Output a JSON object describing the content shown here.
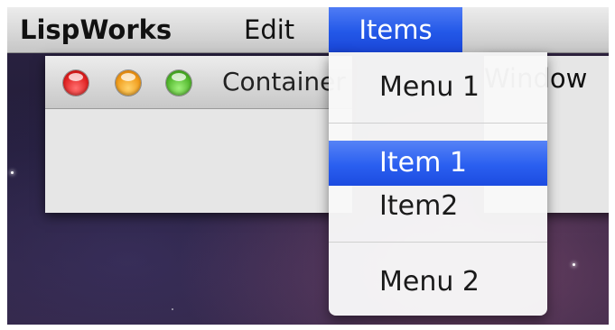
{
  "menubar": {
    "app_name": "LispWorks",
    "menus": [
      {
        "label": "Edit"
      },
      {
        "label": "Items",
        "active": true
      },
      {
        "label": "Window"
      }
    ],
    "highlight_color": "#2358e8"
  },
  "window": {
    "title": "Container",
    "buttons": [
      "close",
      "minimize",
      "zoom"
    ]
  },
  "dropdown": {
    "items": [
      {
        "type": "submenu",
        "label": "Menu 1"
      },
      {
        "type": "separator"
      },
      {
        "type": "item",
        "label": "Item 1",
        "highlighted": true
      },
      {
        "type": "item",
        "label": "Item2"
      },
      {
        "type": "separator"
      },
      {
        "type": "submenu",
        "label": "Menu 2"
      }
    ]
  }
}
